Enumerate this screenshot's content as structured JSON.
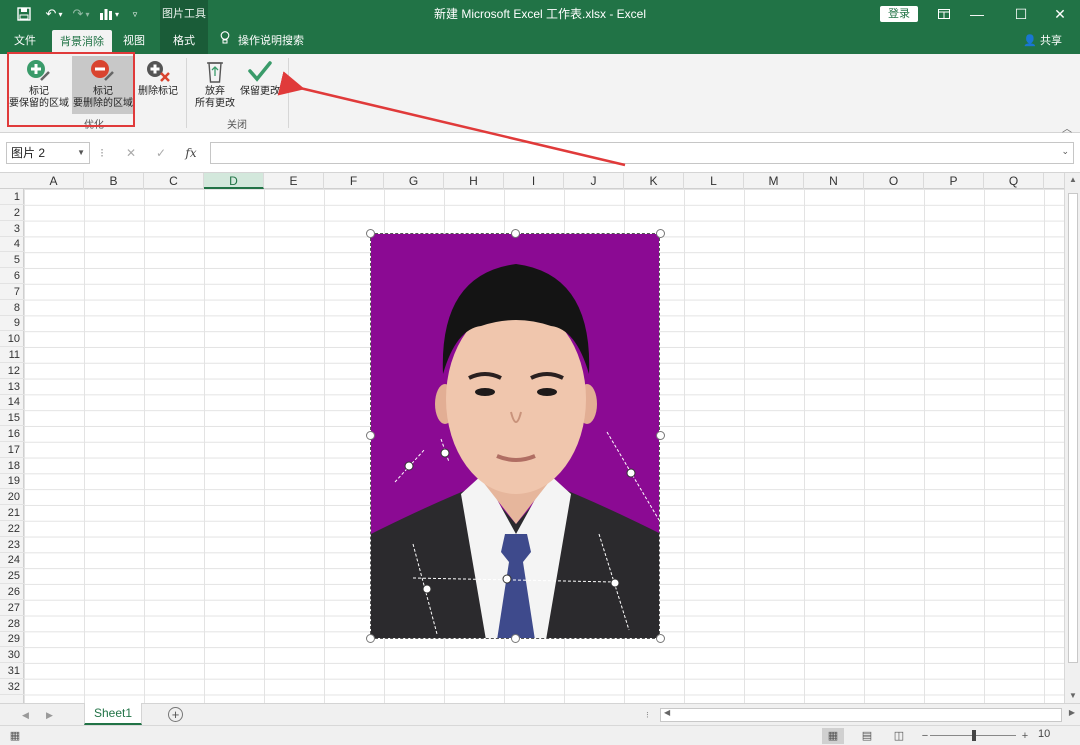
{
  "titlebar": {
    "context_tool_label": "图片工具",
    "title": "新建 Microsoft Excel 工作表.xlsx  -  Excel",
    "login": "登录",
    "minimize": "—",
    "maximize": "☐",
    "close": "✕"
  },
  "tabs": [
    {
      "label": "文件"
    },
    {
      "label": "背景消除",
      "active": true
    },
    {
      "label": "视图"
    },
    {
      "label": "格式",
      "context": true
    }
  ],
  "tell_me": "操作说明搜索",
  "share": "共享",
  "ribbon": {
    "mark_keep": {
      "line1": "标记",
      "line2": "要保留的区域"
    },
    "mark_remove": {
      "line1": "标记",
      "line2": "要删除的区域"
    },
    "delete_mark": "删除标记",
    "refine_group": "优化",
    "discard": {
      "line1": "放弃",
      "line2": "所有更改"
    },
    "keep_changes": "保留更改",
    "close_group": "关闭"
  },
  "formula_bar": {
    "name_box": "图片 2",
    "cancel": "✕",
    "enter": "✓",
    "fx": "fx",
    "value": ""
  },
  "columns": [
    "A",
    "B",
    "C",
    "D",
    "E",
    "F",
    "G",
    "H",
    "I",
    "J",
    "K",
    "L",
    "M",
    "N",
    "O",
    "P",
    "Q"
  ],
  "selected_column": "D",
  "rows": [
    "1",
    "2",
    "3",
    "4",
    "5",
    "6",
    "7",
    "8",
    "9",
    "10",
    "11",
    "12",
    "13",
    "14",
    "15",
    "16",
    "17",
    "18",
    "19",
    "20",
    "21",
    "22",
    "23",
    "24",
    "25",
    "26",
    "27",
    "28",
    "29",
    "30",
    "31",
    "32"
  ],
  "sheet_tab": "Sheet1",
  "add_sheet": "+",
  "zoom": "10",
  "colors": {
    "excel_green": "#217346",
    "photo_background": "#8b0a93",
    "annotation_red": "#e03a3a"
  }
}
